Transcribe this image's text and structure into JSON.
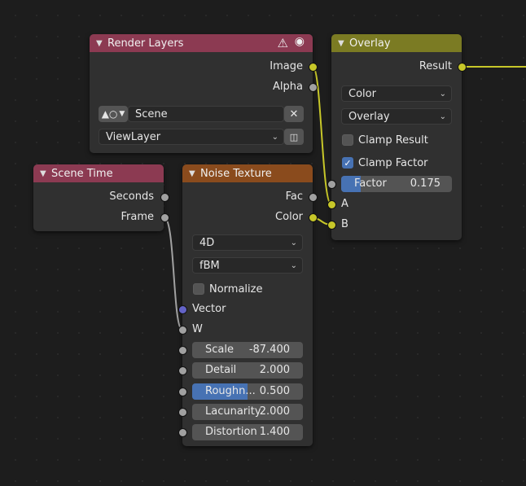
{
  "render_layers": {
    "title": "Render Layers",
    "outputs": [
      "Image",
      "Alpha"
    ],
    "scene_value": "Scene",
    "view_layer_value": "ViewLayer"
  },
  "overlay": {
    "title": "Overlay",
    "output": "Result",
    "data_type": "Color",
    "blend_mode": "Overlay",
    "clamp_result": "Clamp Result",
    "clamp_factor": "Clamp Factor",
    "factor_label": "Factor",
    "factor_value": "0.175",
    "factor_fraction": 0.175,
    "inputs": [
      "A",
      "B"
    ]
  },
  "scene_time": {
    "title": "Scene Time",
    "outputs": [
      "Seconds",
      "Frame"
    ]
  },
  "noise_texture": {
    "title": "Noise Texture",
    "outputs": [
      "Fac",
      "Color"
    ],
    "dimensions": "4D",
    "noise_type": "fBM",
    "normalize": "Normalize",
    "inputs": [
      "Vector",
      "W"
    ],
    "fields": [
      {
        "label": "Scale",
        "value": "-87.400",
        "fraction": 0
      },
      {
        "label": "Detail",
        "value": "2.000",
        "fraction": 0
      },
      {
        "label": "Roughn...",
        "value": "0.500",
        "fraction": 0.5
      },
      {
        "label": "Lacunarity",
        "value": "2.000",
        "fraction": 0
      },
      {
        "label": "Distortion",
        "value": "1.400",
        "fraction": 0
      }
    ]
  },
  "colors": {
    "render_header": "#8c3a52",
    "overlay_header": "#7b7b23",
    "noise_header": "#8a4b1d",
    "link_yellow": "#c7c729",
    "link_grey": "#a1a1a1"
  }
}
